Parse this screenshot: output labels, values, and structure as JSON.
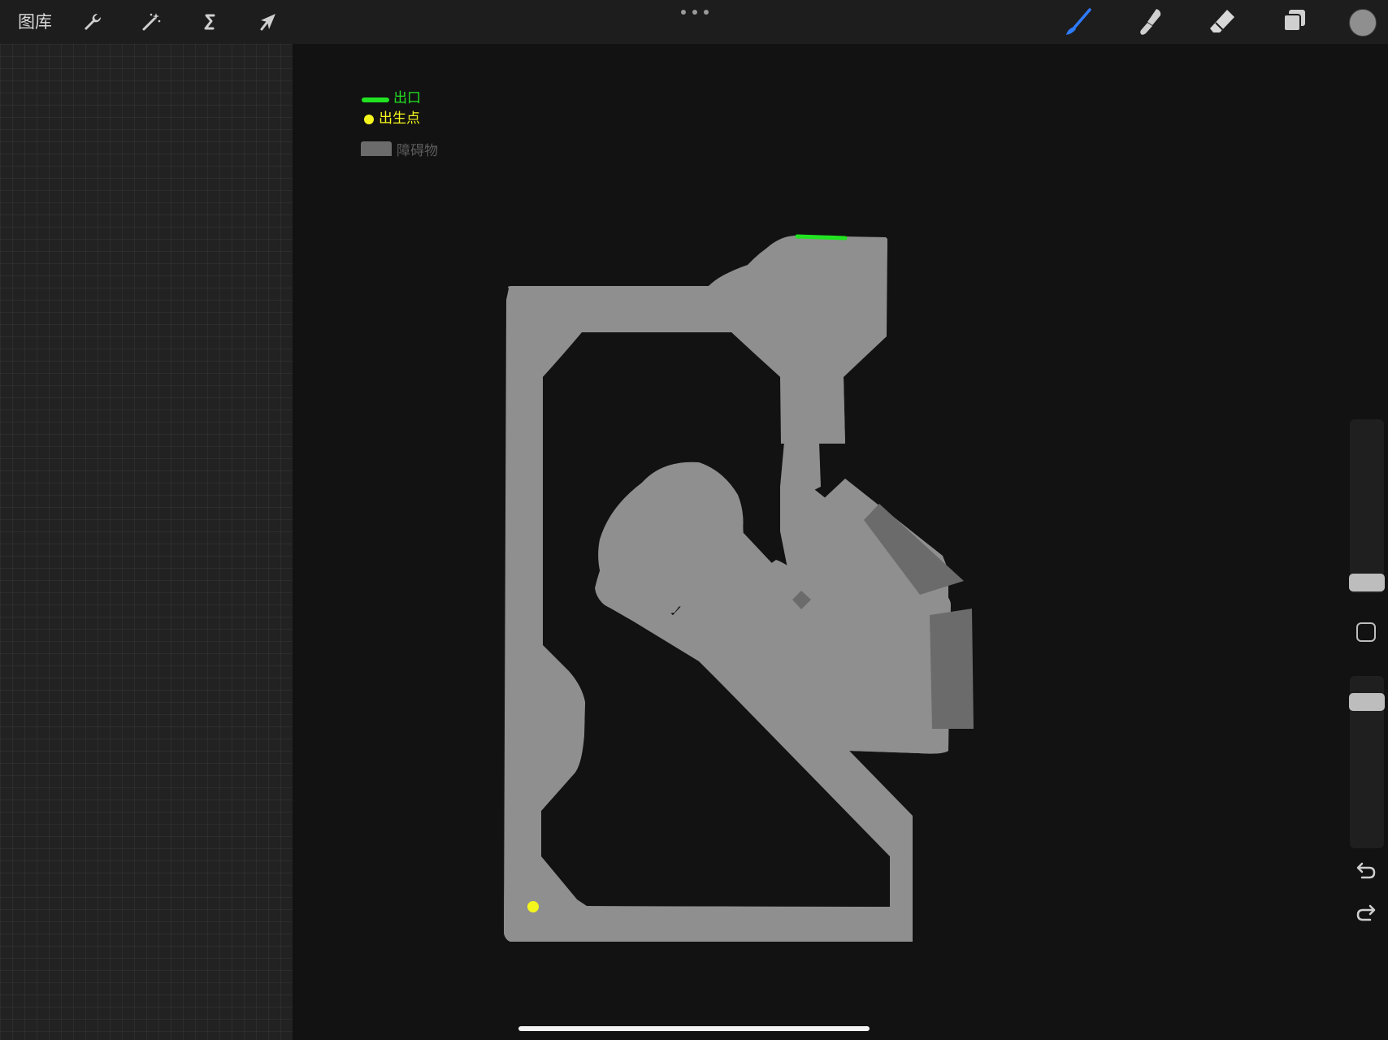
{
  "toolbar": {
    "gallery_label": "图库",
    "left_tools": [
      "wrench-icon",
      "magic-wand-icon",
      "selection-s-icon",
      "transform-arrow-icon"
    ],
    "right_tools": [
      "brush-icon",
      "smudge-icon",
      "eraser-icon",
      "layers-icon"
    ],
    "active_tool": "brush-icon",
    "active_color": "#2f7bff",
    "current_color": "#8f8f8f"
  },
  "legend": {
    "exit_label": "出口",
    "exit_color": "#22e322",
    "spawn_label": "出生点",
    "spawn_color": "#f5f51e",
    "obstacle_label": "障碍物",
    "obstacle_color": "#6b6b6b"
  },
  "map": {
    "floor_color": "#8f8f8f",
    "background_color": "#121212"
  },
  "sidebar": {
    "undo_icon": "undo-icon",
    "redo_icon": "redo-icon",
    "modify_icon": "square-modify-icon"
  }
}
